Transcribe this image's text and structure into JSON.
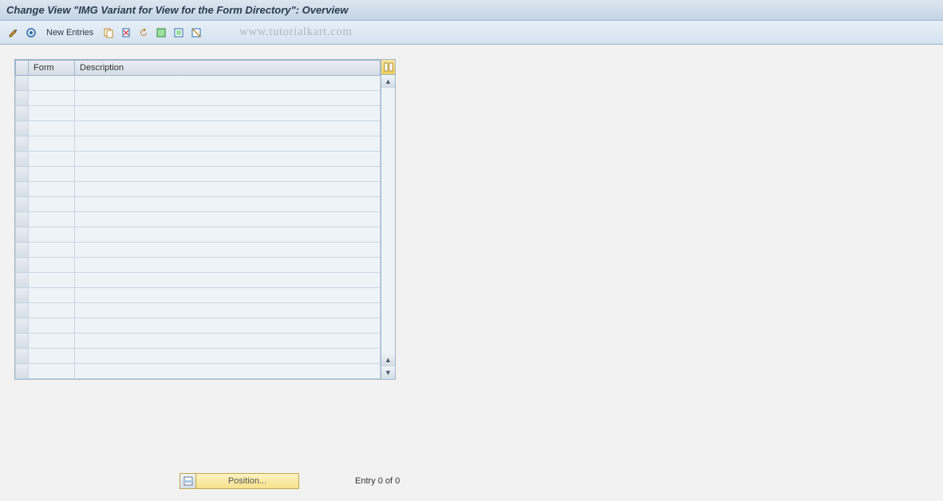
{
  "title": "Change View \"IMG Variant for View for the Form Directory\": Overview",
  "toolbar": {
    "new_entries": "New Entries"
  },
  "watermark": "www.tutorialkart.com",
  "table": {
    "columns": {
      "form": "Form",
      "description": "Description"
    },
    "row_count": 20
  },
  "footer": {
    "position_label": "Position...",
    "entry_text": "Entry 0 of 0"
  }
}
